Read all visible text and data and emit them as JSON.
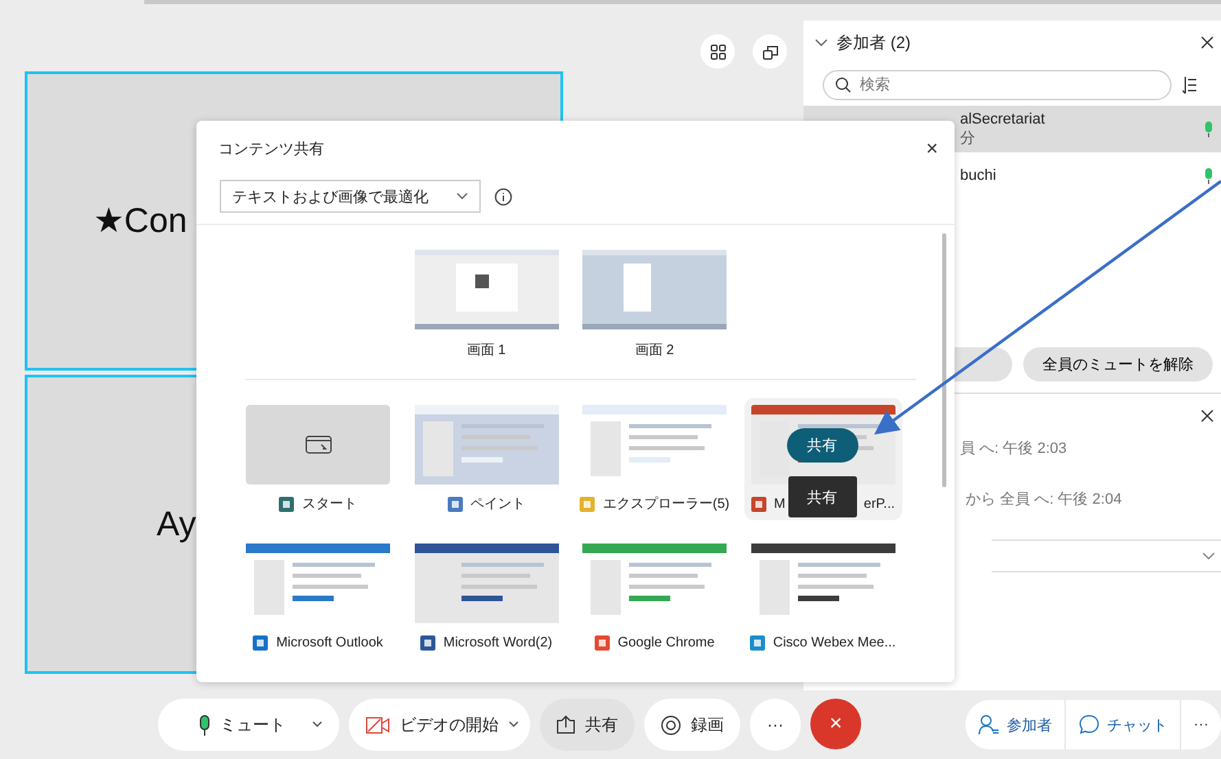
{
  "view_buttons": [
    {
      "kind": "grid"
    },
    {
      "kind": "popout"
    }
  ],
  "tiles": [
    {
      "name": "★Con",
      "selected": true
    },
    {
      "name": "Ay",
      "selected": true
    }
  ],
  "participants": {
    "title": "参加者 (2)",
    "expanded": true,
    "search": {
      "placeholder": "検索"
    },
    "rows": [
      {
        "name": "alSecretariat",
        "sub": "分",
        "selected": true,
        "mic_on": true
      },
      {
        "name": "buchi",
        "selected": false,
        "mic_on": true
      }
    ],
    "buttons": [
      {
        "kind": "hidden"
      },
      {
        "kind": "unmute_all",
        "label": "全員のミュートを解除"
      }
    ]
  },
  "chat": {
    "messages": [
      {
        "text": "員 へ:  午後 2:03"
      },
      {
        "text": "から 全員 へ:  午後 2:04"
      }
    ]
  },
  "dialog": {
    "title": "コンテンツ共有",
    "close": "×",
    "optimize": "テキストおよび画像で最適化",
    "screens": [
      {
        "label": "画面 1"
      },
      {
        "label": "画面 2"
      }
    ],
    "apps": [
      {
        "label": "スタート",
        "kind": "start",
        "selected": false
      },
      {
        "label": "ペイント",
        "kind": "paint",
        "selected": false
      },
      {
        "label": "エクスプローラー(5)",
        "kind": "explorer",
        "selected": false
      },
      {
        "label": "M",
        "label_tail": "erP...",
        "kind": "powerpoint",
        "selected": true,
        "share_button": "共有",
        "tooltip": "共有"
      },
      {
        "label": "Microsoft Outlook",
        "kind": "outlook",
        "selected": false
      },
      {
        "label": "Microsoft Word(2)",
        "kind": "word",
        "selected": false
      },
      {
        "label": "Google Chrome",
        "kind": "chrome",
        "selected": false
      },
      {
        "label": "Cisco Webex Mee...",
        "kind": "webex",
        "selected": false
      }
    ]
  },
  "toolbar": [
    {
      "kind": "mute",
      "label": "ミュート",
      "dropdown": true,
      "selected": false
    },
    {
      "kind": "video",
      "label": "ビデオの開始",
      "dropdown": true,
      "selected": false
    },
    {
      "kind": "share",
      "label": "共有",
      "dropdown": false,
      "selected": true
    },
    {
      "kind": "record",
      "label": "録画",
      "dropdown": false,
      "selected": false
    },
    {
      "kind": "more",
      "label": "···",
      "dropdown": false,
      "selected": false
    },
    {
      "kind": "end",
      "label": "×",
      "dropdown": false,
      "selected": false
    }
  ],
  "panel_toolbar": [
    {
      "kind": "participants",
      "label": "参加者"
    },
    {
      "kind": "chat",
      "label": "チャット"
    },
    {
      "kind": "more",
      "label": "···"
    }
  ]
}
